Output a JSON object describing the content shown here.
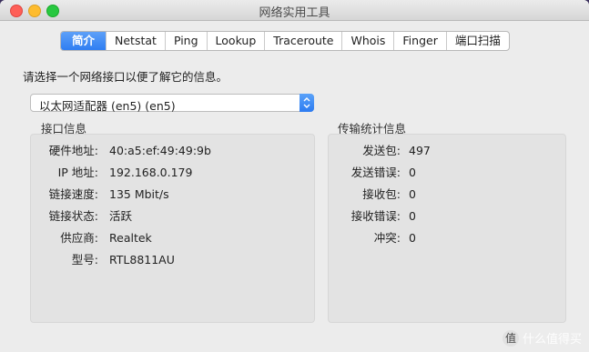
{
  "window": {
    "title": "网络实用工具"
  },
  "tabs": [
    {
      "label": "简介",
      "active": true
    },
    {
      "label": "Netstat",
      "active": false
    },
    {
      "label": "Ping",
      "active": false
    },
    {
      "label": "Lookup",
      "active": false
    },
    {
      "label": "Traceroute",
      "active": false
    },
    {
      "label": "Whois",
      "active": false
    },
    {
      "label": "Finger",
      "active": false
    },
    {
      "label": "端口扫描",
      "active": false
    }
  ],
  "prompt": "请选择一个网络接口以便了解它的信息。",
  "interface_select": {
    "value": "以太网适配器 (en5) (en5)"
  },
  "interface_info": {
    "title": "接口信息",
    "rows": [
      {
        "label": "硬件地址:",
        "value": "40:a5:ef:49:49:9b"
      },
      {
        "label": "IP 地址:",
        "value": "192.168.0.179"
      },
      {
        "label": "链接速度:",
        "value": "135 Mbit/s"
      },
      {
        "label": "链接状态:",
        "value": "活跃"
      },
      {
        "label": "供应商:",
        "value": "Realtek"
      },
      {
        "label": "型号:",
        "value": "RTL8811AU"
      }
    ]
  },
  "transfer_stats": {
    "title": "传输统计信息",
    "rows": [
      {
        "label": "发送包:",
        "value": "497"
      },
      {
        "label": "发送错误:",
        "value": "0"
      },
      {
        "label": "接收包:",
        "value": "0"
      },
      {
        "label": "接收错误:",
        "value": "0"
      },
      {
        "label": "冲突:",
        "value": "0"
      }
    ]
  },
  "watermark": {
    "text": "什么值得买",
    "badge": "值"
  }
}
